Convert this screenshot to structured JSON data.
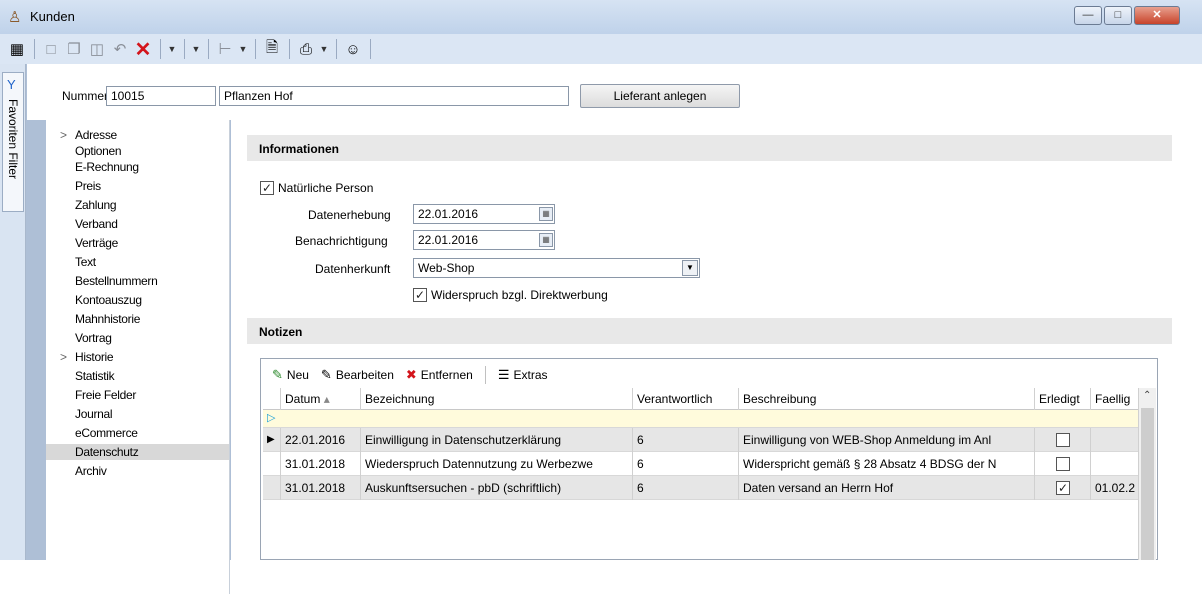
{
  "window": {
    "title": "Kunden",
    "buttons": [
      "minimize",
      "maximize",
      "close"
    ]
  },
  "toolbar": {
    "icons": [
      "first-record-icon",
      "previous-record-icon",
      "refresh-nav-icon",
      "next-record-icon",
      "last-record-icon",
      "table-view-icon",
      "refresh-icon",
      "new-document-icon",
      "copy-icon",
      "save-icon",
      "undo-icon",
      "delete-icon",
      "tools-icon",
      "filter-icon",
      "tree-icon",
      "export-icon",
      "print-icon",
      "users-icon",
      "info-icon"
    ]
  },
  "sidepanel": {
    "tab_label": "Favoriten Filter"
  },
  "header": {
    "nummer_label": "Nummer",
    "nummer_value": "10015",
    "name_value": "Pflanzen Hof",
    "lieferant_button": "Lieferant anlegen"
  },
  "nav": {
    "items": [
      {
        "label": "Adresse",
        "expandable": true
      },
      {
        "label": "Optionen"
      },
      {
        "label": "E-Rechnung"
      },
      {
        "label": "Preis"
      },
      {
        "label": "Zahlung"
      },
      {
        "label": "Verband"
      },
      {
        "label": "Verträge"
      },
      {
        "label": "Text"
      },
      {
        "label": "Bestellnummern"
      },
      {
        "label": "Kontoauszug"
      },
      {
        "label": "Mahnhistorie"
      },
      {
        "label": "Vortrag"
      },
      {
        "label": "Historie",
        "expandable": true
      },
      {
        "label": "Statistik"
      },
      {
        "label": "Freie Felder"
      },
      {
        "label": "Journal"
      },
      {
        "label": "eCommerce"
      },
      {
        "label": "Datenschutz",
        "selected": true
      },
      {
        "label": "Archiv"
      }
    ]
  },
  "info": {
    "section_title": "Informationen",
    "natuerliche_person": {
      "label": "Natürliche Person",
      "checked": true
    },
    "datenerhebung": {
      "label": "Datenerhebung",
      "value": "22.01.2016"
    },
    "benachrichtigung": {
      "label": "Benachrichtigung",
      "value": "22.01.2016"
    },
    "datenherkunft": {
      "label": "Datenherkunft",
      "value": "Web-Shop"
    },
    "widerspruch": {
      "label": "Widerspruch bzgl. Direktwerbung",
      "checked": true
    }
  },
  "notizen": {
    "section_title": "Notizen",
    "toolbar": {
      "neu": "Neu",
      "bearbeiten": "Bearbeiten",
      "entfernen": "Entfernen",
      "extras": "Extras"
    },
    "columns": [
      "Datum",
      "Bezeichnung",
      "Verantwortlich",
      "Beschreibung",
      "Erledigt",
      "Faellig"
    ],
    "rows": [
      {
        "datum": "22.01.2016",
        "bezeichnung": "Einwilligung in Datenschutzerklärung",
        "verantwortlich": "6",
        "beschreibung": "Einwilligung von WEB-Shop Anmeldung im Anl",
        "erledigt": false,
        "faellig": "",
        "current": true
      },
      {
        "datum": "31.01.2018",
        "bezeichnung": "Wiederspruch Datennutzung zu Werbezwe",
        "verantwortlich": "6",
        "beschreibung": "Widerspricht gemäß § 28 Absatz 4 BDSG der N",
        "erledigt": false,
        "faellig": ""
      },
      {
        "datum": "31.01.2018",
        "bezeichnung": "Auskunftsersuchen - pbD (schriftlich)",
        "verantwortlich": "6",
        "beschreibung": "Daten versand an Herrn Hof",
        "erledigt": true,
        "faellig": "01.02.2"
      }
    ]
  },
  "colors": {
    "selected_row": "#e6e6e6",
    "new_row": "#fffbdc",
    "nav_accent": "#1f63c9",
    "delete_red": "#d3141b"
  }
}
